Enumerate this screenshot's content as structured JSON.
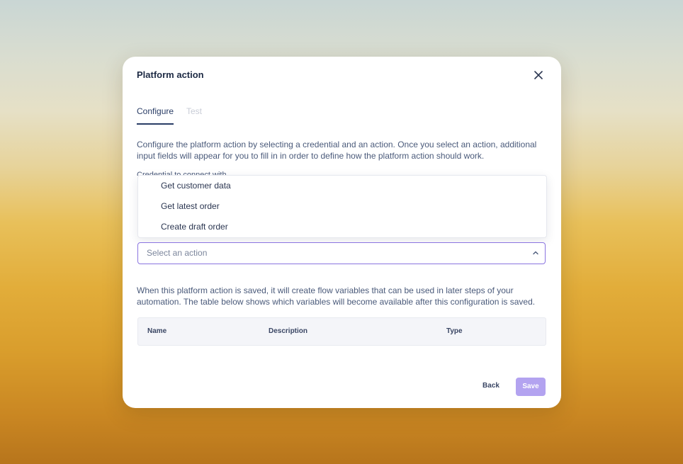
{
  "modal": {
    "title": "Platform action",
    "close_icon": "close-icon"
  },
  "tabs": [
    {
      "label": "Configure",
      "active": true
    },
    {
      "label": "Test",
      "active": false
    }
  ],
  "intro_text": "Configure the platform action by selecting a credential and an action. Once you select an action, additional input fields will appear for you to fill in in order to define how the platform action should work.",
  "credential_label": "Credential to connect with",
  "action_dropdown": {
    "options": [
      "Get customer data",
      "Get latest order",
      "Create draft order"
    ]
  },
  "action_select": {
    "placeholder": "Select an action",
    "icon": "chevron-up-icon"
  },
  "variables_text": "When this platform action is saved, it will create flow variables that can be used in later steps of your automation. The table below shows which variables will become available after this configuration is saved.",
  "variables_table": {
    "columns": [
      "Name",
      "Description",
      "Type"
    ],
    "rows": []
  },
  "footer": {
    "back_label": "Back",
    "save_label": "Save"
  },
  "colors": {
    "accent": "#8a74e0",
    "save_button": "#b3a3f0",
    "text_dark": "#1d2a44"
  }
}
